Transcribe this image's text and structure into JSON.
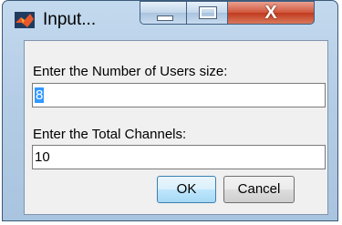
{
  "window": {
    "title": "Input...",
    "close_glyph": "X"
  },
  "dialog": {
    "prompt1_label": "Enter the Number of Users size:",
    "prompt1_value": "8",
    "prompt2_label": "Enter the Total Channels:",
    "prompt2_value": "10",
    "ok_label": "OK",
    "cancel_label": "Cancel"
  },
  "colors": {
    "titlebar": "#b9d1ea",
    "close_button": "#c7432a",
    "selection": "#3399ff"
  },
  "icons": [
    "matlab-icon",
    "minimize-icon",
    "maximize-icon",
    "close-icon"
  ]
}
